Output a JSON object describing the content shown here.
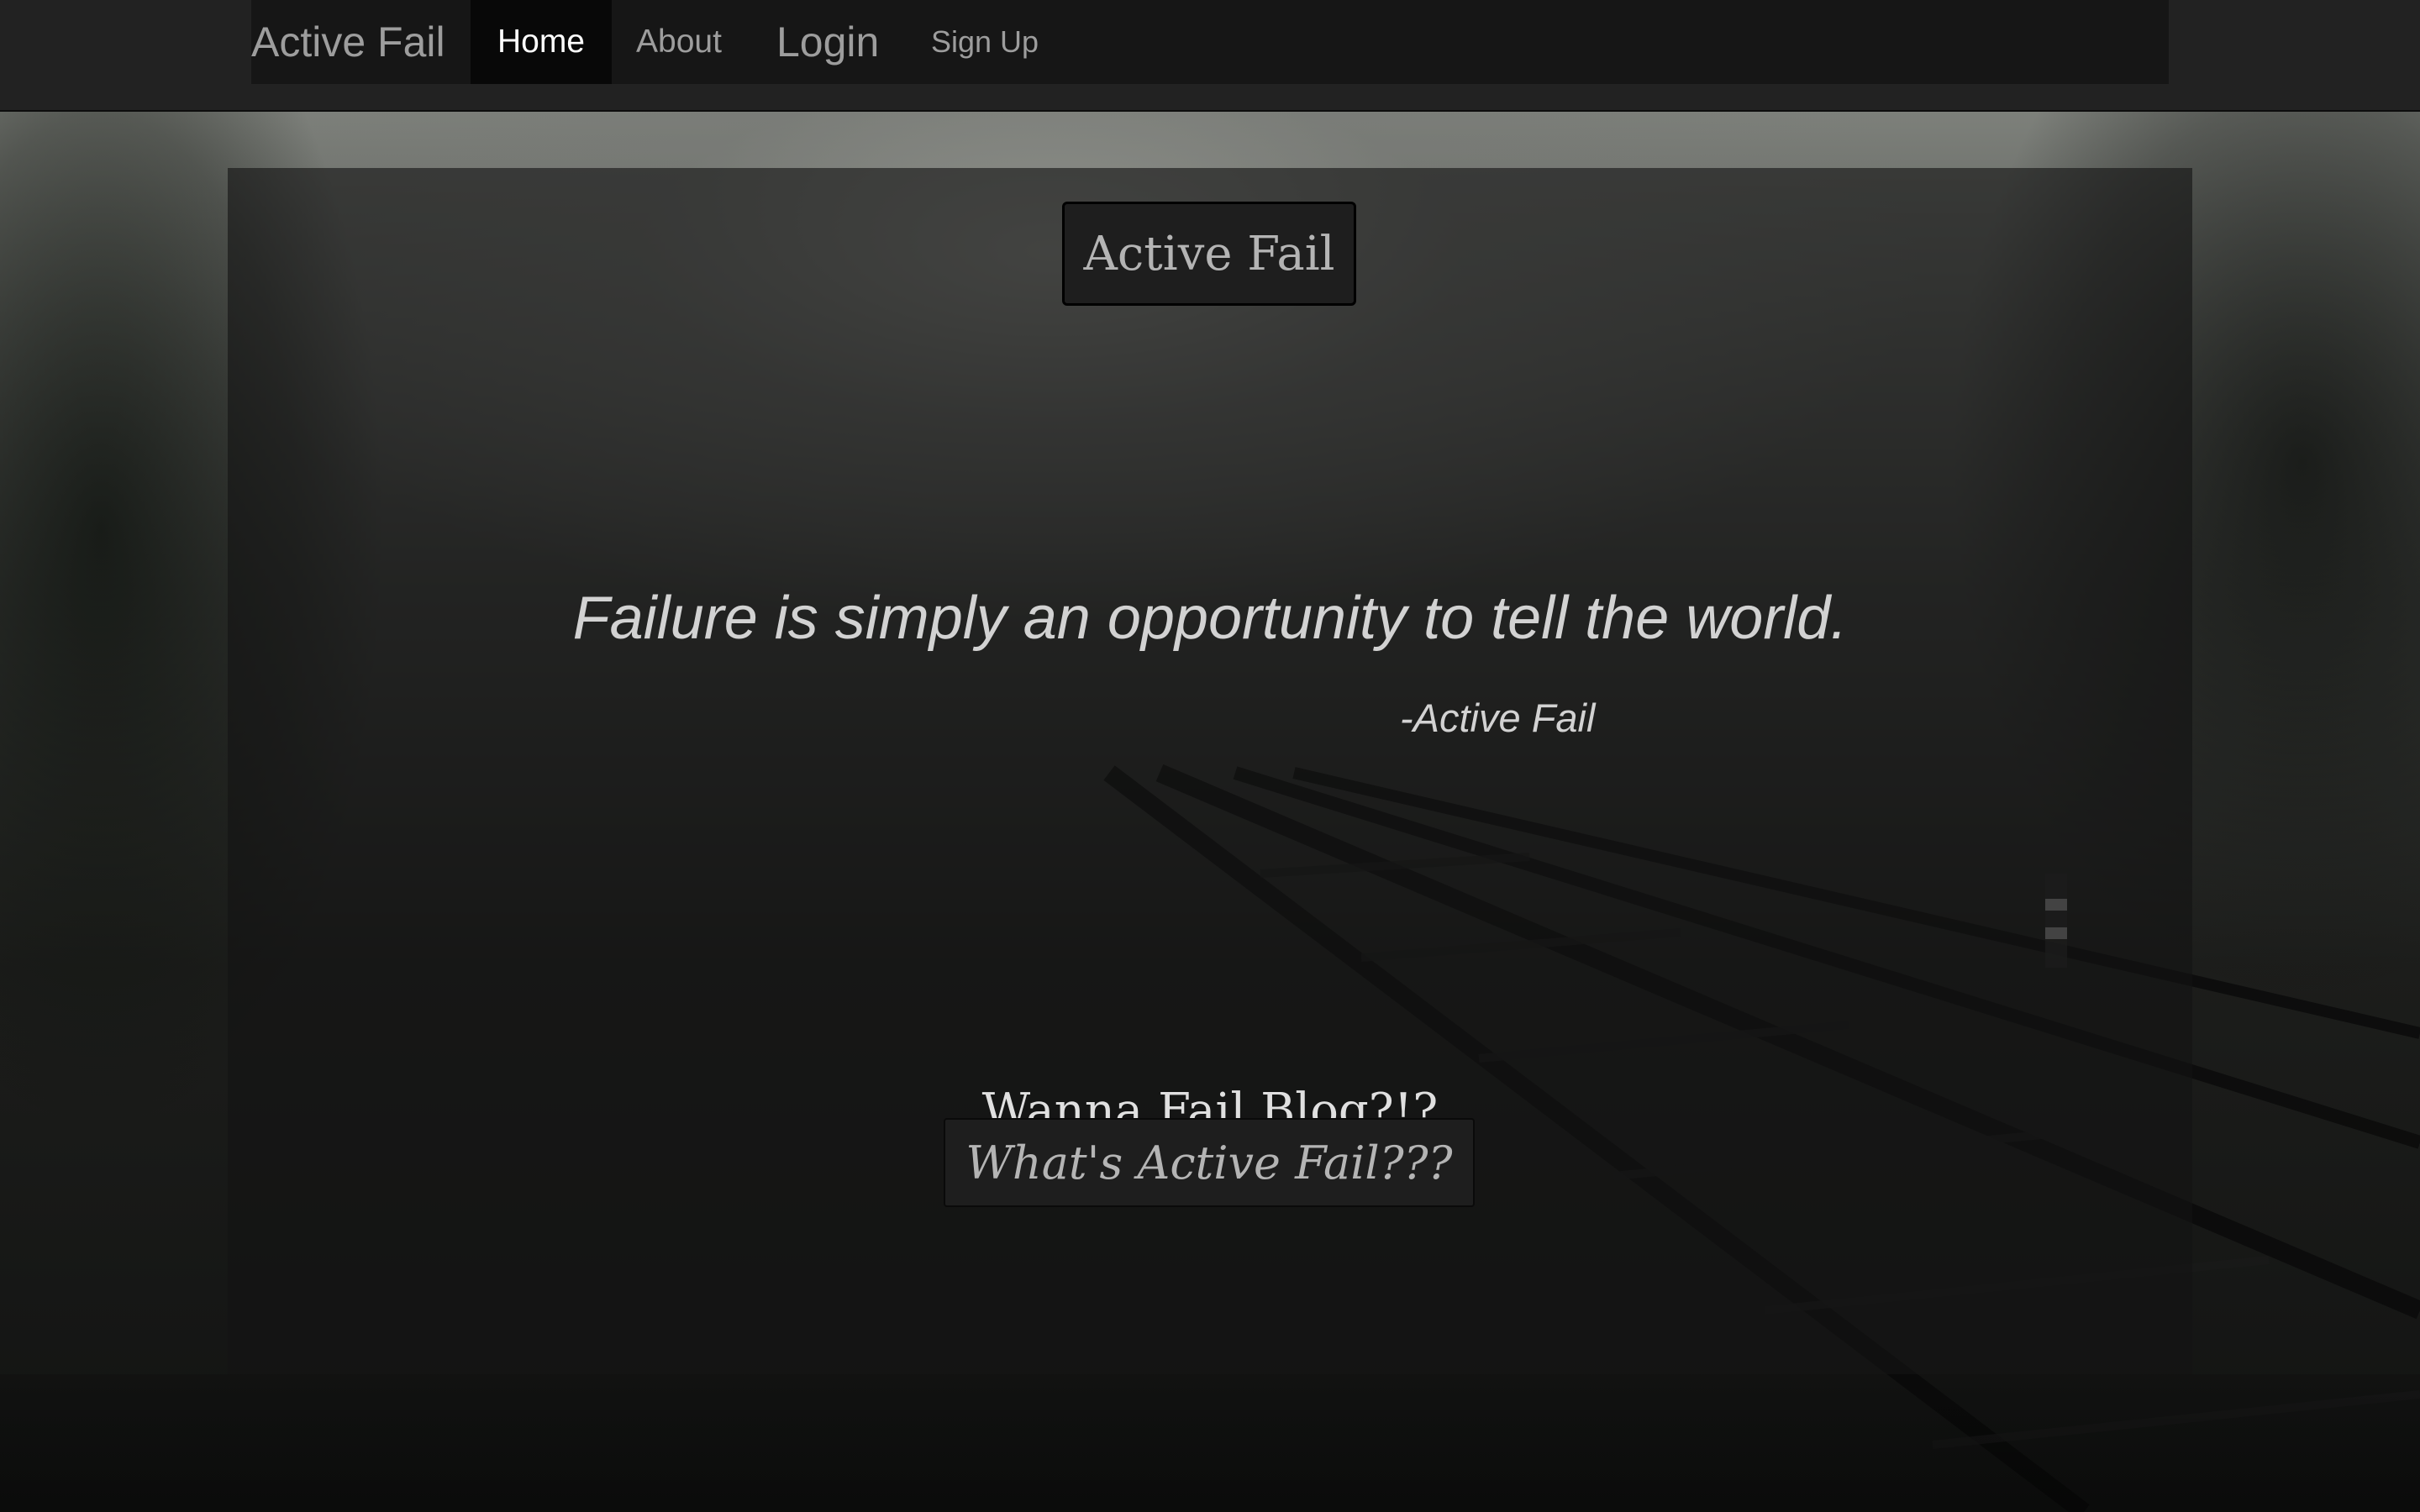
{
  "navbar": {
    "brand": "Active Fail",
    "items": [
      {
        "label": "Home",
        "active": true
      },
      {
        "label": "About"
      },
      {
        "label": "Login"
      },
      {
        "label": "Sign Up"
      }
    ]
  },
  "main": {
    "title": "Active Fail",
    "quote": "Failure is simply an opportunity to tell the world.",
    "attribution": "-Active Fail",
    "blog_text": "Wanna Fail Blog?!?",
    "cta_label": "What's Active Fail???"
  },
  "colors": {
    "navbar_bg": "#222222",
    "nav_active_bg": "#080808",
    "nav_text": "#9d9d9d",
    "text_light": "#d2d2d2"
  }
}
